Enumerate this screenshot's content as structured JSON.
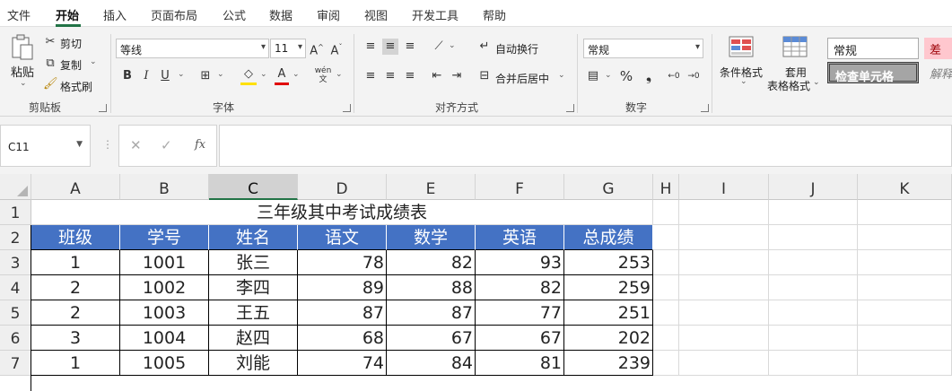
{
  "menu": [
    "文件",
    "开始",
    "插入",
    "页面布局",
    "公式",
    "数据",
    "审阅",
    "视图",
    "开发工具",
    "帮助"
  ],
  "ribbon": {
    "clipboard": {
      "paste": "粘贴",
      "cut": "剪切",
      "copy": "复制",
      "format_painter": "格式刷",
      "group": "剪贴板"
    },
    "font": {
      "name": "等线",
      "size": "11",
      "group": "字体",
      "bold": "B",
      "italic": "I",
      "underline": "U",
      "wen": "wén"
    },
    "alignment": {
      "wrap": "自动换行",
      "merge": "合并后居中",
      "group": "对齐方式"
    },
    "number": {
      "format": "常规",
      "percent": "%",
      "group": "数字"
    },
    "styles": {
      "conditional": "条件格式",
      "table_format_line1": "套用",
      "table_format_line2": "表格格式",
      "normal": "常规",
      "bad": "差",
      "check_cell": "检查单元格",
      "explain": "解释"
    }
  },
  "formula_bar": {
    "name_box": "C11",
    "value": ""
  },
  "columns": [
    "A",
    "B",
    "C",
    "D",
    "E",
    "F",
    "G",
    "H",
    "I",
    "J",
    "K"
  ],
  "rows": [
    "1",
    "2",
    "3",
    "4",
    "5",
    "6",
    "7"
  ],
  "sheet": {
    "title": "三年级其中考试成绩表",
    "headers": [
      "班级",
      "学号",
      "姓名",
      "语文",
      "数学",
      "英语",
      "总成绩"
    ],
    "data": [
      [
        "1",
        "1001",
        "张三",
        "78",
        "82",
        "93",
        "253"
      ],
      [
        "2",
        "1002",
        "李四",
        "89",
        "88",
        "82",
        "259"
      ],
      [
        "2",
        "1003",
        "王五",
        "87",
        "87",
        "77",
        "251"
      ],
      [
        "3",
        "1004",
        "赵四",
        "68",
        "67",
        "67",
        "202"
      ],
      [
        "1",
        "1005",
        "刘能",
        "74",
        "84",
        "81",
        "239"
      ]
    ]
  },
  "colors": {
    "accent": "#217346",
    "header_fill": "#4472c4",
    "bad_fill": "#ffc7ce",
    "bad_text": "#9c0006",
    "check_fill": "#a5a5a5"
  }
}
